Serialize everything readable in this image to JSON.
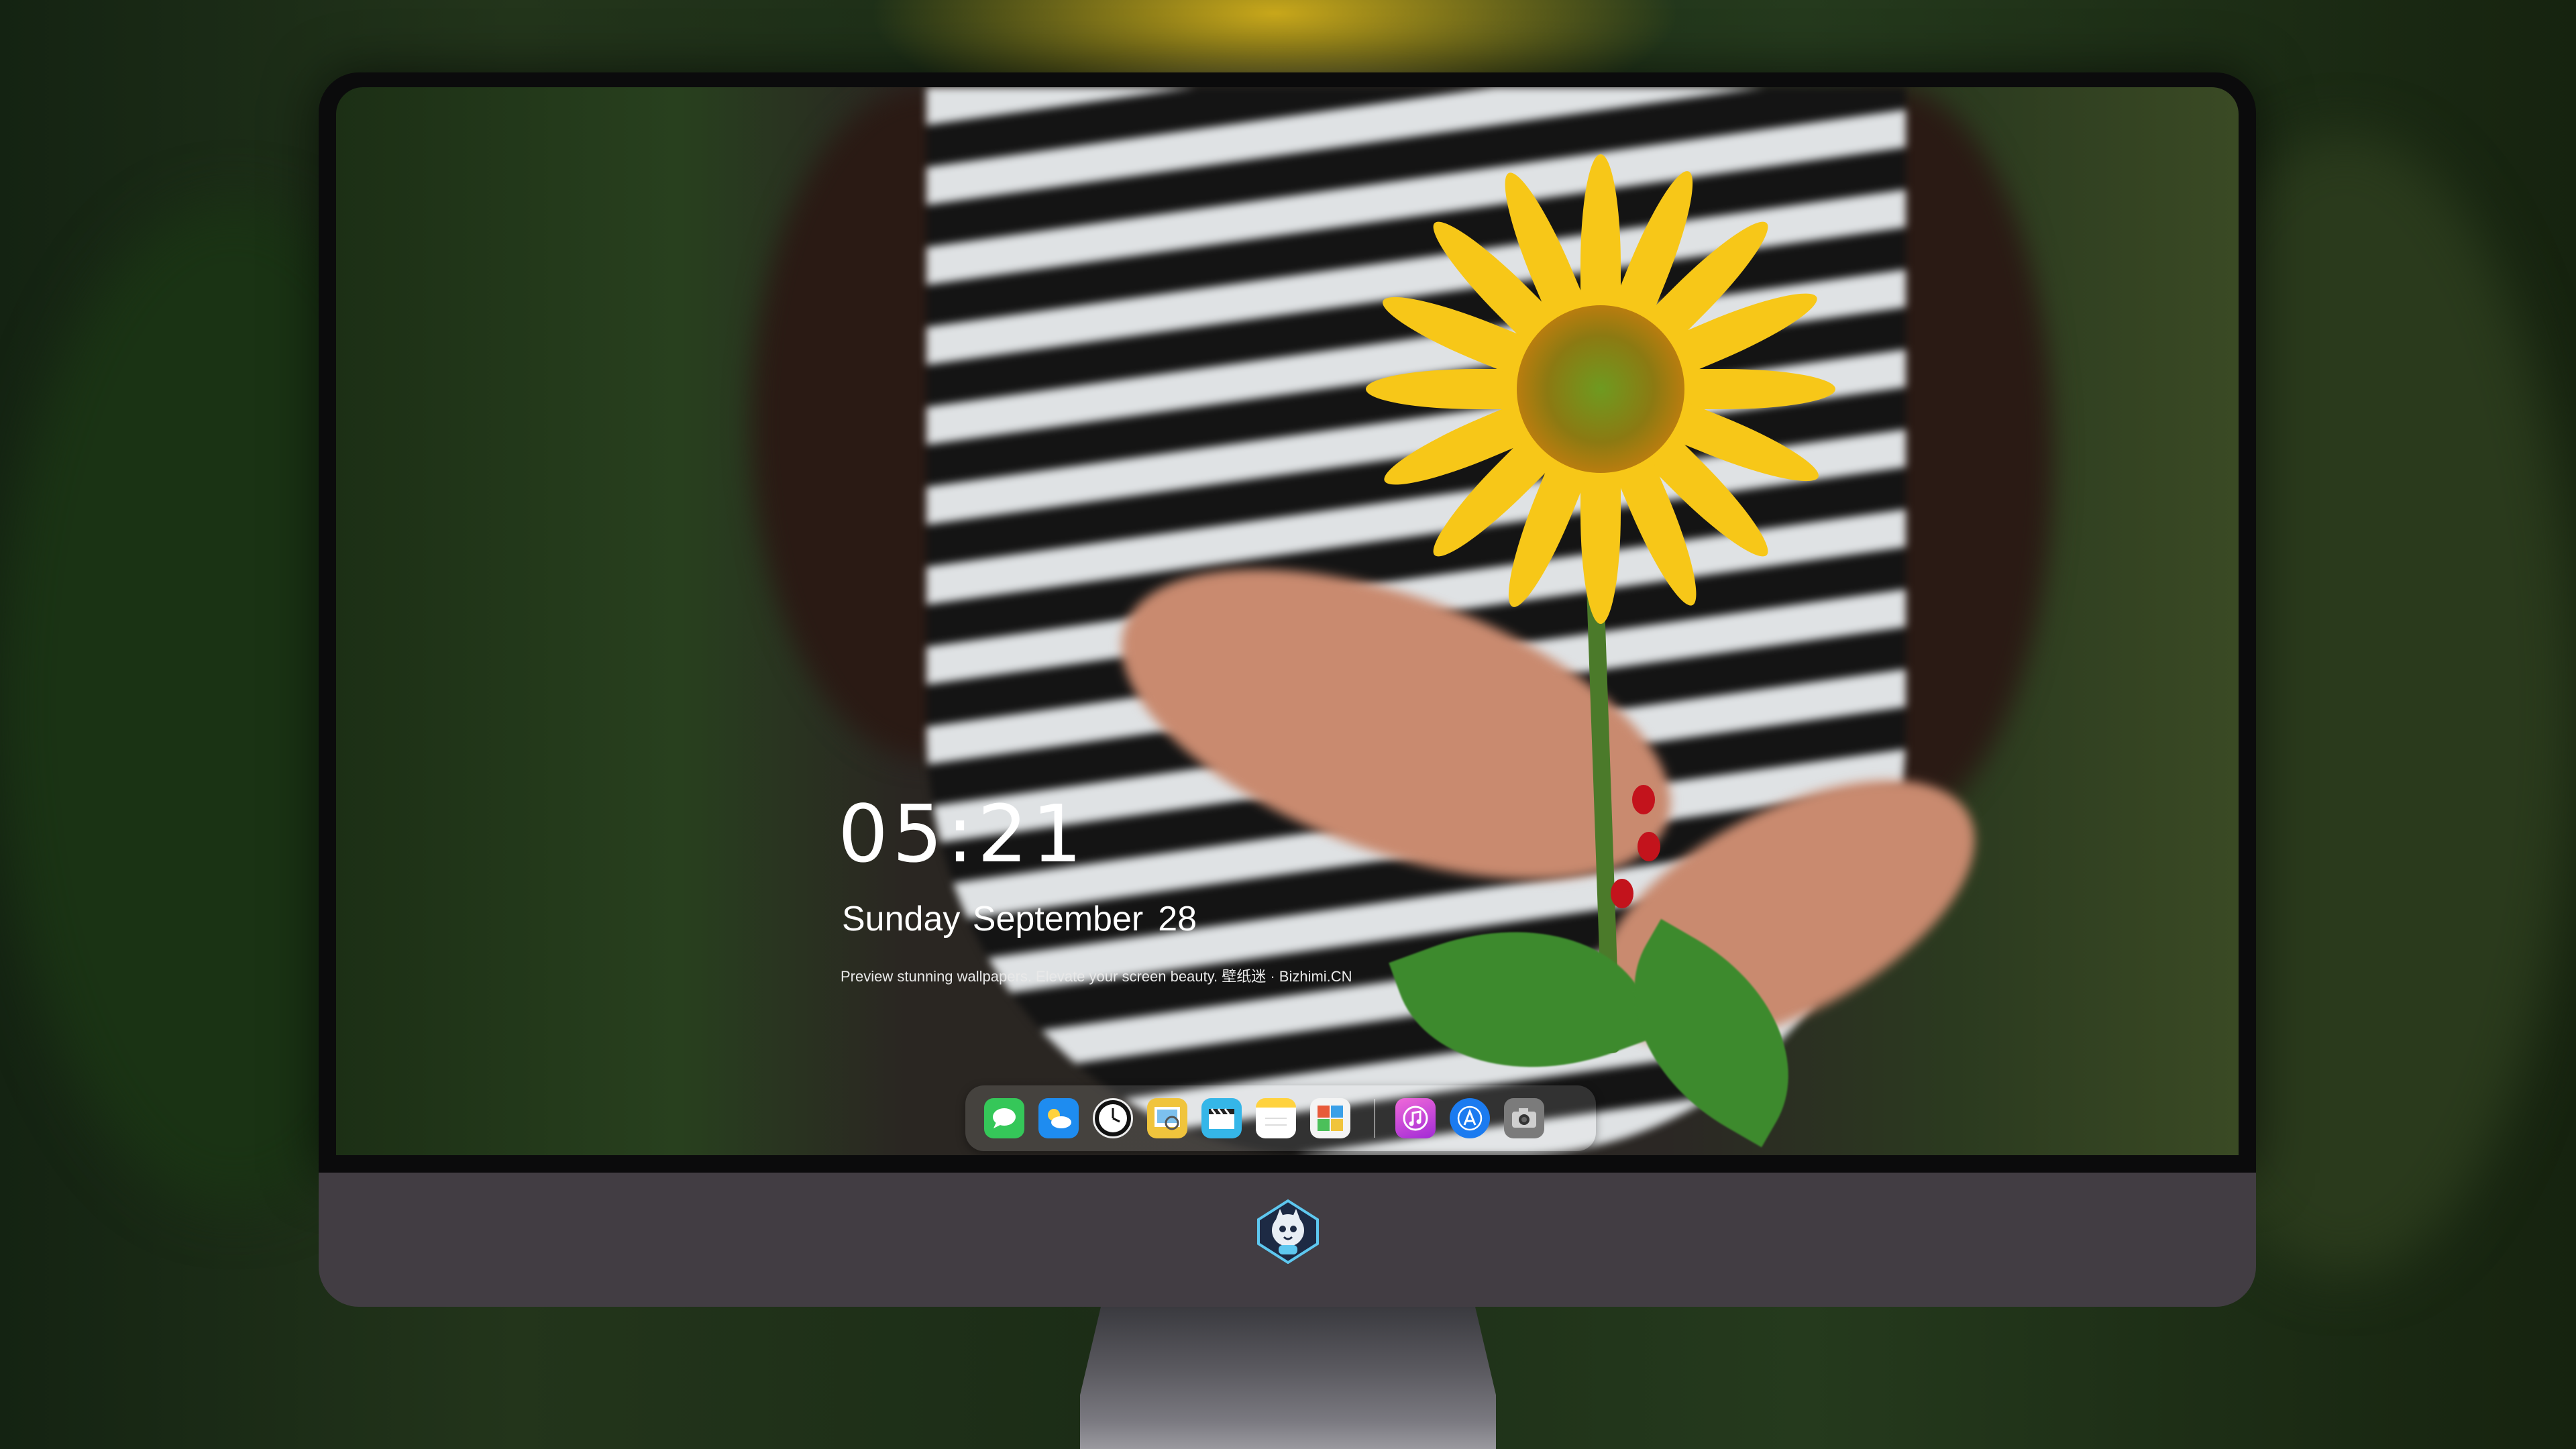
{
  "lockscreen": {
    "time": "05:21",
    "date_text": "Sunday September",
    "date_day": "28",
    "tagline": "Preview stunning wallpapers. Elevate your screen beauty. 壁纸迷 · Bizhimi.CN"
  },
  "dock": {
    "apps": [
      {
        "icon": "messages-icon",
        "color": "#35c759"
      },
      {
        "icon": "weather-icon",
        "color": "#1e8cf0"
      },
      {
        "icon": "clock-icon",
        "color": "#111111"
      },
      {
        "icon": "preview-icon",
        "color": "#f0c43c"
      },
      {
        "icon": "clips-icon",
        "color": "#35b6e8"
      },
      {
        "icon": "notes-icon",
        "color": "#ffd23e"
      },
      {
        "icon": "photo-booth-icon",
        "color": "#e85a3a"
      }
    ],
    "recent": [
      {
        "icon": "itunes-icon",
        "color": "#d43cd6"
      },
      {
        "icon": "app-store-icon",
        "color": "#1b7bf0"
      },
      {
        "icon": "camera-icon",
        "color": "#7b7b7b"
      }
    ]
  },
  "monitor": {
    "logo": "mascot-logo-icon",
    "bezel_color": "#0b0b0c",
    "chin_color": "#423d43"
  }
}
